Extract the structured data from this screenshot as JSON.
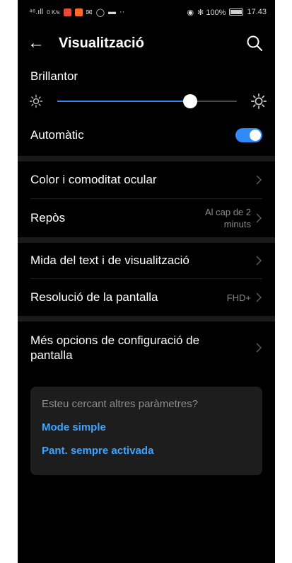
{
  "status_bar": {
    "left_text": "⁴⁶.ıll",
    "speed": "0 K/s",
    "right_text": "✻ 100%",
    "time": "17.43"
  },
  "header": {
    "title": "Visualització"
  },
  "brightness": {
    "label": "Brillantor",
    "level": 0.74
  },
  "automatic": {
    "label": "Automàtic",
    "enabled": true
  },
  "rows": {
    "eye_comfort": {
      "label": "Color i comoditat ocular"
    },
    "sleep": {
      "label": "Repòs",
      "value": "Al cap de 2 minuts"
    },
    "text_size": {
      "label": "Mida del text i de visualització"
    },
    "resolution": {
      "label": "Resolució de la pantalla",
      "value": "FHD+"
    },
    "more": {
      "label": "Més opcions de configuració de pantalla"
    }
  },
  "suggestions": {
    "question": "Esteu cercant altres paràmetres?",
    "links": [
      "Mode simple",
      "Pant. sempre activada"
    ]
  },
  "colors": {
    "accent": "#2f8af8",
    "link": "#3ea4ff",
    "background": "#000000"
  }
}
